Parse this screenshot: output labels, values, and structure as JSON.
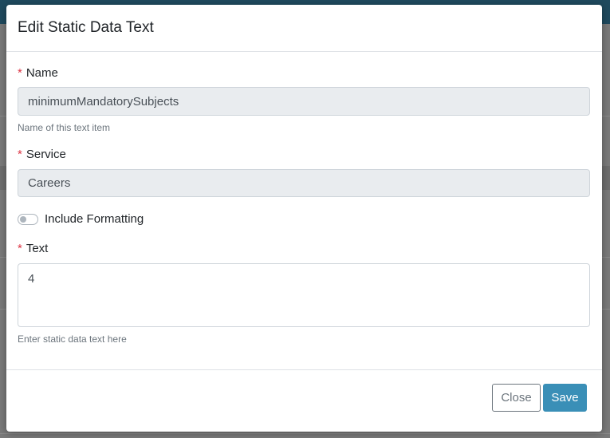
{
  "modal": {
    "title": "Edit Static Data Text",
    "fields": {
      "name": {
        "label": "Name",
        "required_marker": "*",
        "value": "minimumMandatorySubjects",
        "help": "Name of this text item"
      },
      "service": {
        "label": "Service",
        "required_marker": "*",
        "value": "Careers"
      },
      "include_formatting": {
        "label": "Include Formatting",
        "checked": false
      },
      "text": {
        "label": "Text",
        "required_marker": "*",
        "value": "4",
        "help": "Enter static data text here"
      }
    },
    "footer": {
      "close_label": "Close",
      "save_label": "Save"
    }
  },
  "colors": {
    "accent": "#3a8fb7",
    "required": "#dc3545",
    "readonly_bg": "#e9ecef",
    "overlay": "#7a7a7a"
  }
}
